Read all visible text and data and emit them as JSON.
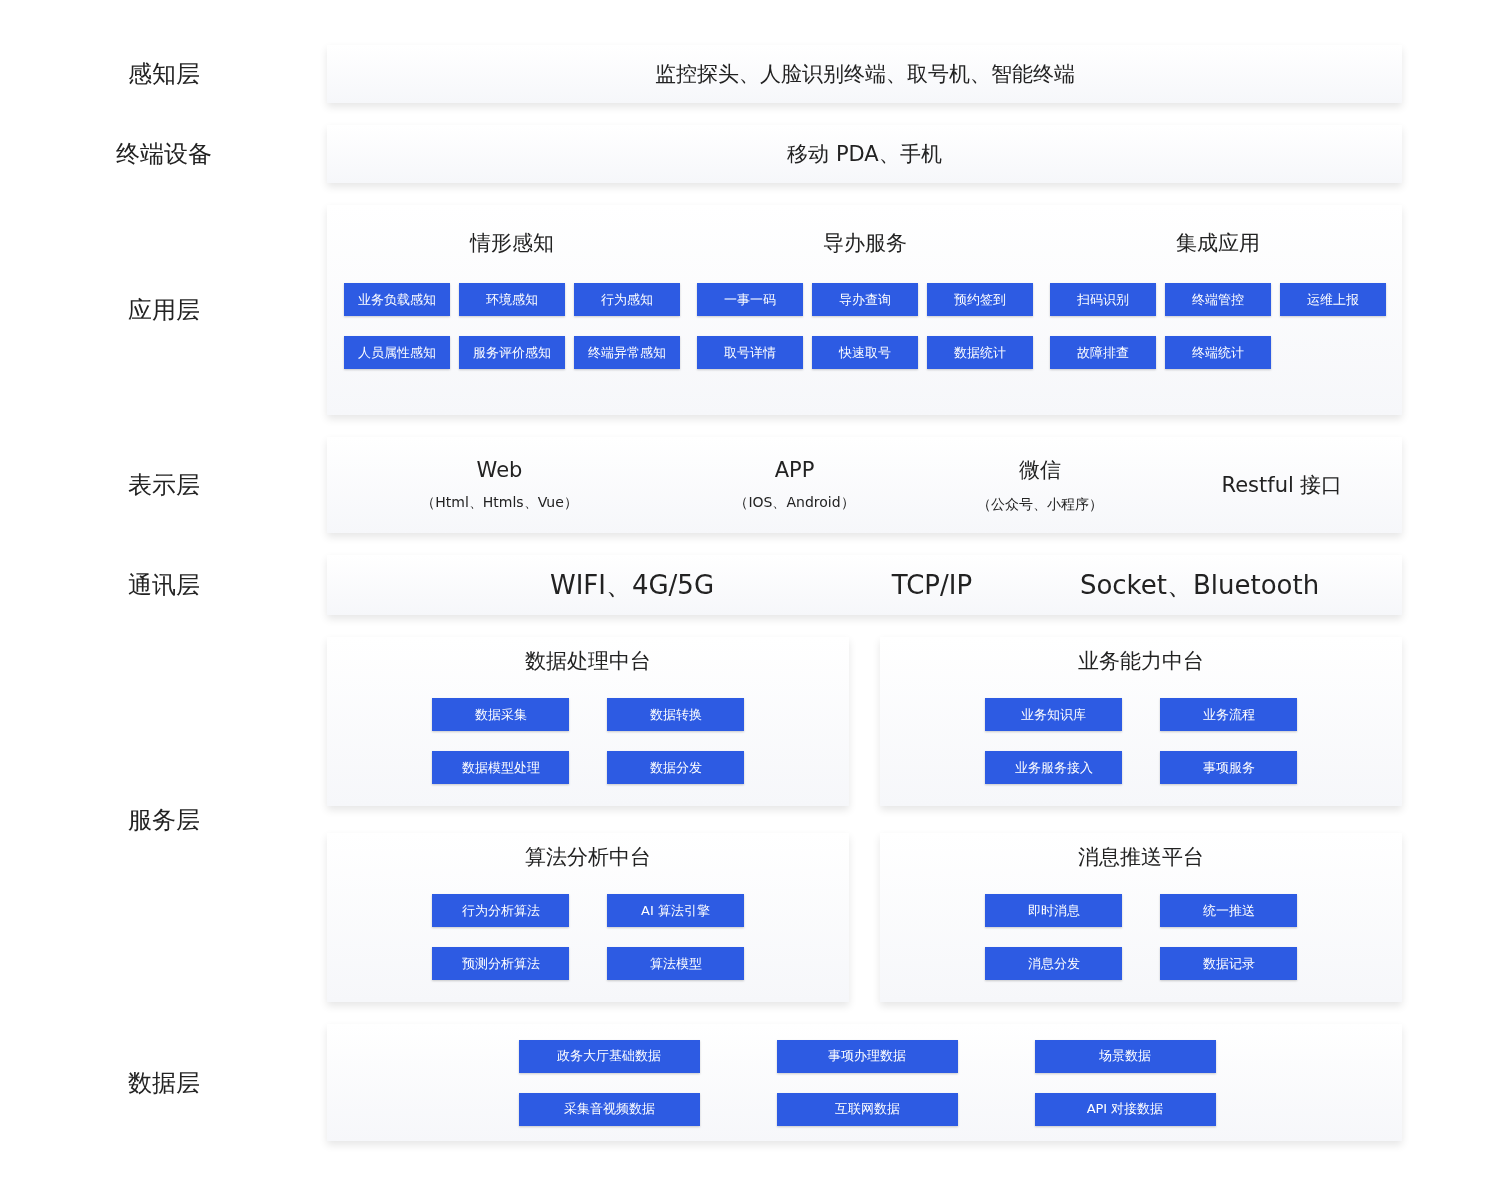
{
  "layers": [
    {
      "label": "感知层",
      "kind": "text",
      "text": "监控探头、人脸识别终端、取号机、智能终端"
    },
    {
      "label": "终端设备",
      "kind": "text",
      "text": "移动 PDA、手机"
    },
    {
      "label": "应用层",
      "kind": "apps",
      "groups": [
        {
          "title": "情形感知",
          "items": [
            "业务负载感知",
            "环境感知",
            "行为感知",
            "人员属性感知",
            "服务评价感知",
            "终端异常感知"
          ]
        },
        {
          "title": "导办服务",
          "items": [
            "一事一码",
            "导办查询",
            "预约签到",
            "取号详情",
            "快速取号",
            "数据统计"
          ]
        },
        {
          "title": "集成应用",
          "items": [
            "扫码识别",
            "终端管控",
            "运维上报",
            "故障排查",
            "终端统计"
          ]
        }
      ]
    },
    {
      "label": "表示层",
      "kind": "platforms",
      "items": [
        {
          "name": "Web",
          "detail": "（Html、Htmls、Vue）"
        },
        {
          "name": "APP",
          "detail": "（IOS、Android）"
        },
        {
          "name": "微信",
          "detail": "（公众号、小程序）"
        },
        {
          "name": "Restful 接口"
        }
      ]
    },
    {
      "label": "通讯层",
      "kind": "protocols",
      "items": [
        "WIFI、4G/5G",
        "TCP/IP",
        "Socket、Bluetooth"
      ]
    },
    {
      "label": "服务层",
      "kind": "centers",
      "cards": [
        {
          "title": "数据处理中台",
          "items": [
            "数据采集",
            "数据转换",
            "数据模型处理",
            "数据分发"
          ]
        },
        {
          "title": "业务能力中台",
          "items": [
            "业务知识库",
            "业务流程",
            "业务服务接入",
            "事项服务"
          ]
        },
        {
          "title": "算法分析中台",
          "items": [
            "行为分析算法",
            "AI 算法引擎",
            "预测分析算法",
            "算法模型"
          ]
        },
        {
          "title": "消息推送平台",
          "items": [
            "即时消息",
            "统一推送",
            "消息分发",
            "数据记录"
          ]
        }
      ]
    },
    {
      "label": "数据层",
      "kind": "data",
      "items": [
        "政务大厅基础数据",
        "事项办理数据",
        "场景数据",
        "采集音视频数据",
        "互联网数据",
        "API 对接数据"
      ]
    }
  ]
}
